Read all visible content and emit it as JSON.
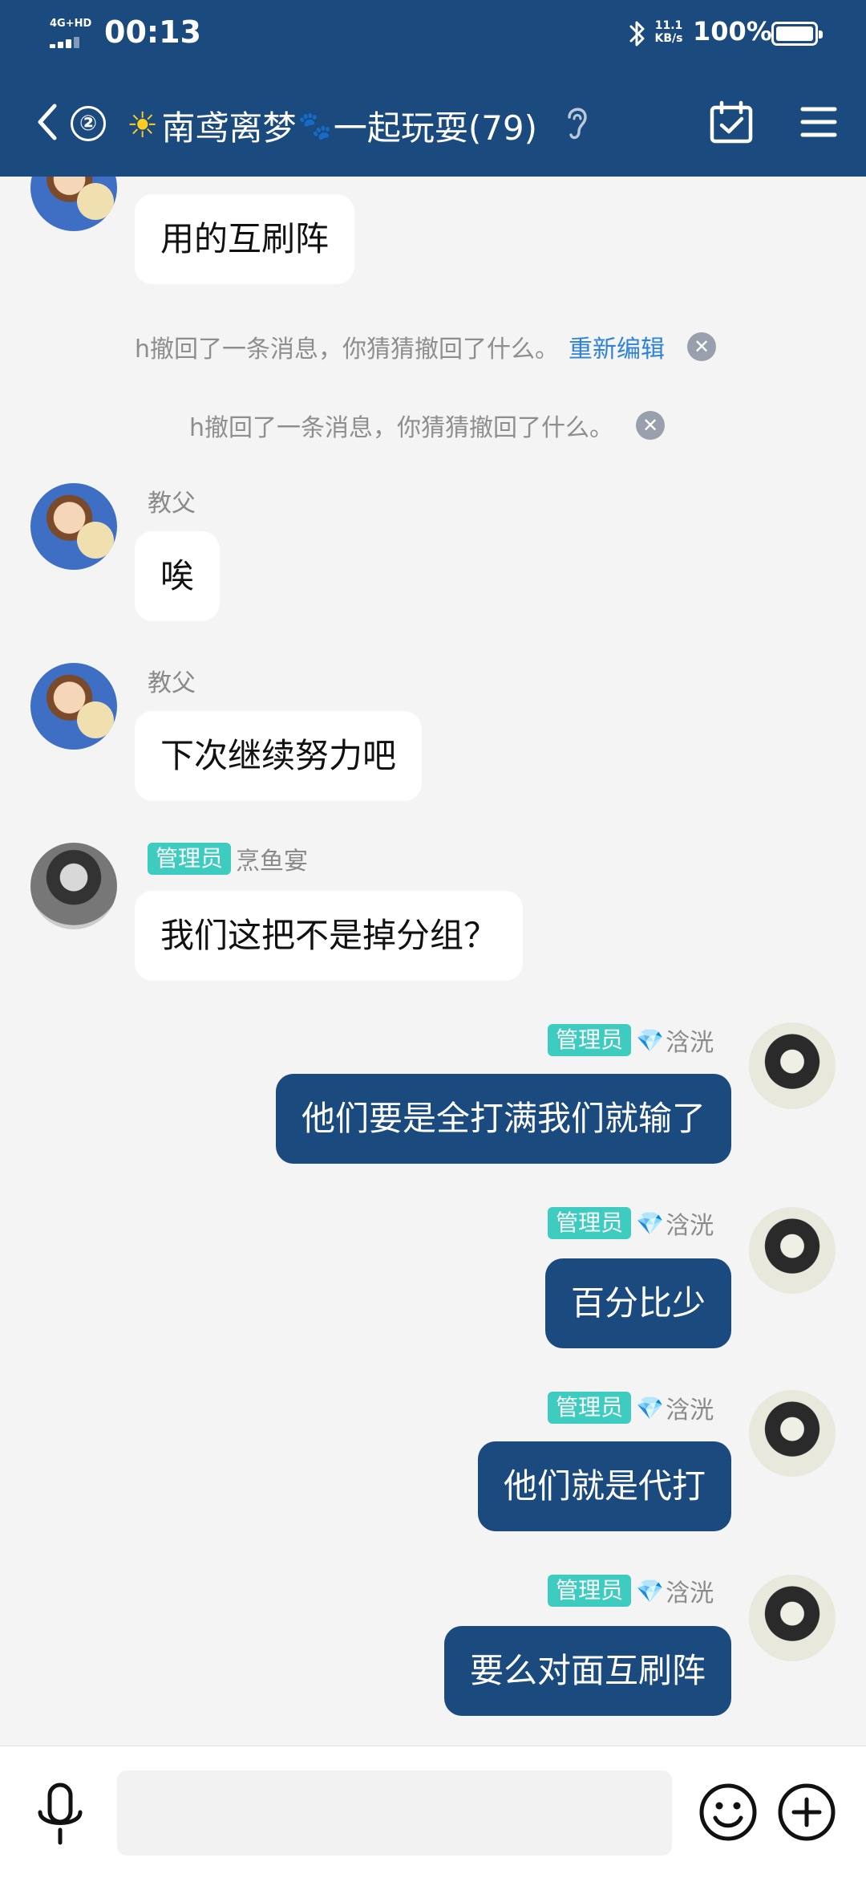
{
  "status_bar": {
    "network": "4G+HD",
    "time": "00:13",
    "speed_value": "11.1",
    "speed_unit": "KB/s",
    "battery": "100%"
  },
  "header": {
    "unread_count": "②",
    "title": "南鸢离梦",
    "title_suffix": "一起玩耍(79)",
    "colors": {
      "bar": "#1b4a7e",
      "accent_badge": "#3ecbc0",
      "link": "#2f82d6"
    }
  },
  "messages": [
    {
      "type": "in",
      "text": "用的互刷阵"
    },
    {
      "type": "system",
      "text": "h撤回了一条消息，你猜猜撤回了什么。",
      "action": "重新编辑"
    },
    {
      "type": "system",
      "text": "h撤回了一条消息，你猜猜撤回了什么。"
    },
    {
      "type": "in",
      "sender": "教父",
      "text": "唉"
    },
    {
      "type": "in",
      "sender": "教父",
      "text": "下次继续努力吧"
    },
    {
      "type": "in",
      "sender": "烹鱼宴",
      "badge": "管理员",
      "text": "我们这把不是掉分组？"
    },
    {
      "type": "out",
      "sender": "浛洸",
      "badge": "管理员",
      "text": "他们要是全打满我们就输了"
    },
    {
      "type": "out",
      "sender": "浛洸",
      "badge": "管理员",
      "text": "百分比少"
    },
    {
      "type": "out",
      "sender": "浛洸",
      "badge": "管理员",
      "text": "他们就是代打"
    },
    {
      "type": "out",
      "sender": "浛洸",
      "badge": "管理员",
      "text": "要么对面互刷阵"
    }
  ],
  "input": {
    "placeholder": ""
  }
}
